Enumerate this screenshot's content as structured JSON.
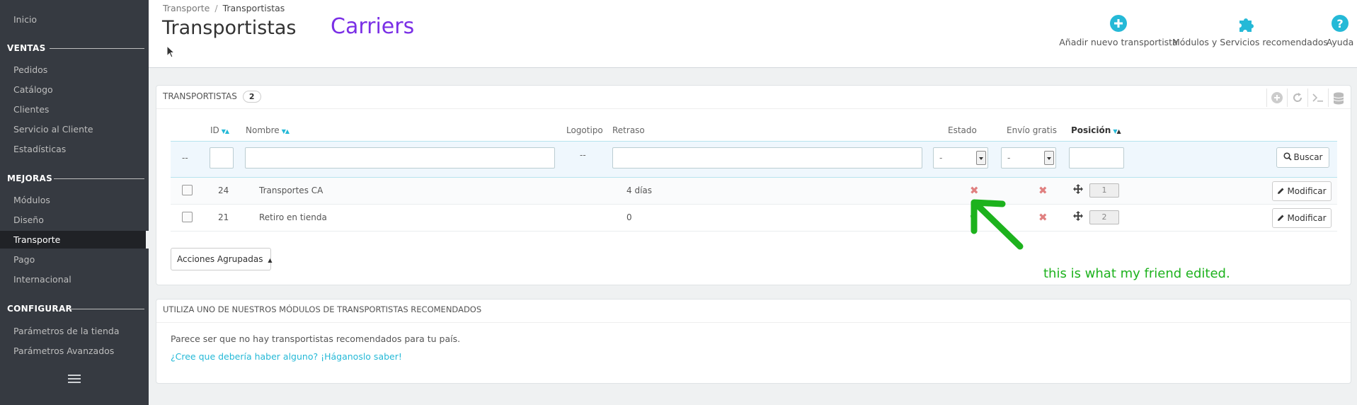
{
  "sidebar": {
    "top_item": "Inicio",
    "sections": [
      {
        "title": "VENTAS",
        "items": [
          "Pedidos",
          "Catálogo",
          "Clientes",
          "Servicio al Cliente",
          "Estadísticas"
        ]
      },
      {
        "title": "MEJORAS",
        "items": [
          "Módulos",
          "Diseño",
          "Transporte",
          "Pago",
          "Internacional"
        ]
      },
      {
        "title": "CONFIGURAR",
        "items": [
          "Parámetros de la tienda",
          "Parámetros Avanzados"
        ]
      }
    ],
    "active_item": "Transporte"
  },
  "header": {
    "breadcrumb": [
      "Transporte",
      "Transportistas"
    ],
    "breadcrumb_sep": "/",
    "title": "Transportistas",
    "annotation": "Carriers",
    "toolbar": [
      {
        "label": "Añadir nuevo transportista",
        "icon": "plus-circle-icon"
      },
      {
        "label": "Módulos y Servicios recomendados",
        "icon": "puzzle-icon"
      },
      {
        "label": "Ayuda",
        "icon": "help-icon"
      }
    ]
  },
  "carriers_panel": {
    "title": "TRANSPORTISTAS",
    "count": "2",
    "heading_icons": [
      "add-icon",
      "refresh-icon",
      "sql-icon",
      "database-icon"
    ],
    "columns": {
      "id": "ID",
      "name": "Nombre",
      "logo": "Logotipo",
      "delay": "Retraso",
      "status": "Estado",
      "free_shipping": "Envío gratis",
      "position": "Posición"
    },
    "filters": {
      "placeholder_dash": "--",
      "status_value": "-",
      "free_shipping_value": "-",
      "search_label": "Buscar"
    },
    "rows": [
      {
        "id": "24",
        "name": "Transportes CA",
        "delay": "4 días",
        "status": "disabled",
        "free_shipping": "disabled",
        "position": "1",
        "action": "Modificar"
      },
      {
        "id": "21",
        "name": "Retiro en tienda",
        "delay": "0",
        "status": "enabled",
        "free_shipping": "disabled",
        "position": "2",
        "action": "Modificar"
      }
    ],
    "bulk_actions_label": "Acciones Agrupadas",
    "annotation_text": "this is what my friend edited.",
    "colors": {
      "accent": "#25b9d7",
      "annotation": "#1db21d",
      "carriers_annotation": "#7a2fe6",
      "error": "#e08080",
      "success": "#72c279"
    }
  },
  "recommended_panel": {
    "title": "UTILIZA UNO DE NUESTROS MÓDULOS DE TRANSPORTISTAS RECOMENDADOS",
    "message": "Parece ser que no hay transportistas recomendados para tu país.",
    "link": "¿Cree que debería haber alguno? ¡Háganoslo saber!"
  }
}
